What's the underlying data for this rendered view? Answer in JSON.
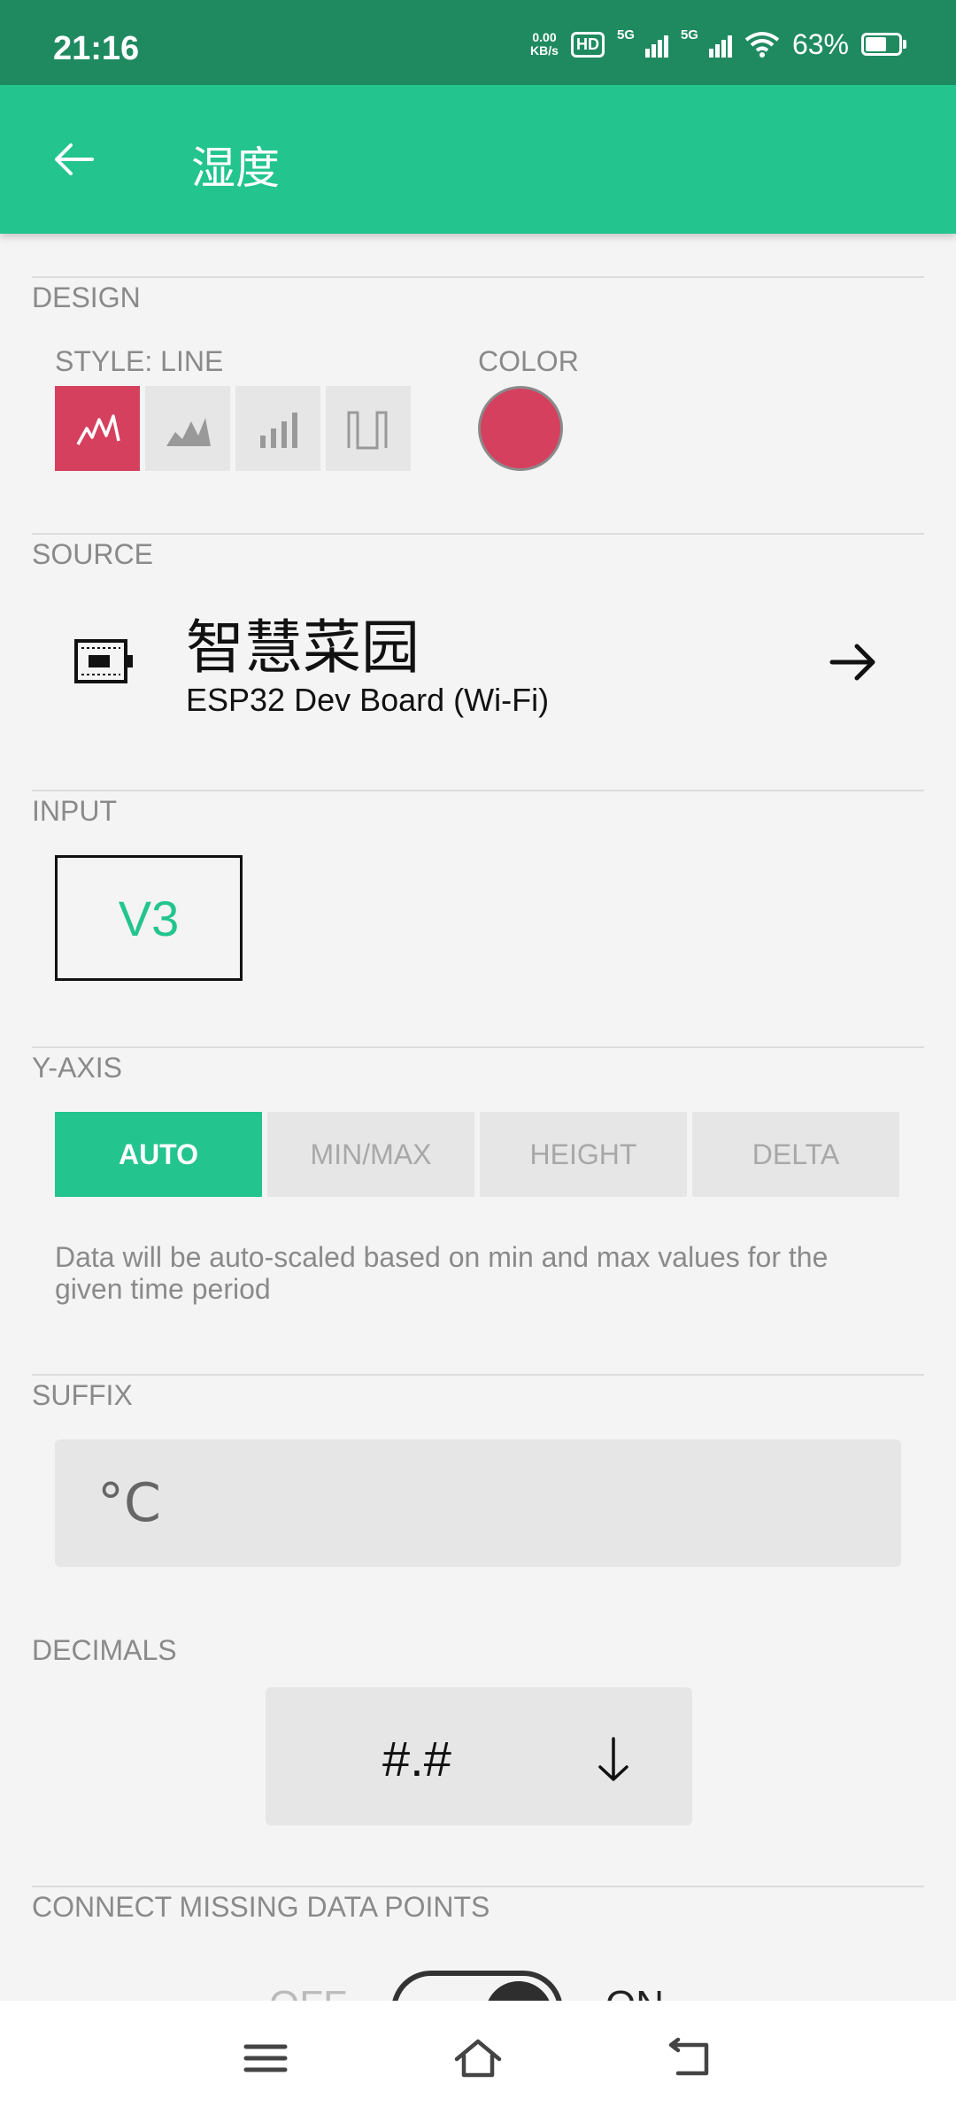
{
  "status_bar": {
    "time": "21:16",
    "net_speed": "0.00",
    "net_unit": "KB/s",
    "hd_label": "HD",
    "signal_1_label": "5G",
    "signal_2_label": "5G",
    "battery_percent": "63%",
    "battery_level": 0.63
  },
  "app_bar": {
    "title": "湿度",
    "back_icon": "arrow-left-icon"
  },
  "design": {
    "section_label": "DESIGN",
    "style_label": "STYLE: LINE",
    "styles": [
      "line",
      "area",
      "bar",
      "binary"
    ],
    "selected_style": "line",
    "color_label": "COLOR",
    "color": "#d6405f"
  },
  "source": {
    "section_label": "SOURCE",
    "device_name": "智慧菜园",
    "device_type": "ESP32 Dev Board (Wi-Fi)",
    "device_icon": "board-icon",
    "arrow_icon": "arrow-right-icon"
  },
  "input": {
    "section_label": "INPUT",
    "pin": "V3",
    "pin_color": "#23c48e"
  },
  "y_axis": {
    "section_label": "Y-AXIS",
    "options": [
      "AUTO",
      "MIN/MAX",
      "HEIGHT",
      "DELTA"
    ],
    "selected": "AUTO",
    "help_text": "Data will be auto-scaled based on min and max values for the given time period"
  },
  "suffix": {
    "section_label": "SUFFIX",
    "value": "°C"
  },
  "decimals": {
    "section_label": "DECIMALS",
    "value": "#.#",
    "dropdown_icon": "arrow-down-icon"
  },
  "connect_missing": {
    "section_label": "CONNECT MISSING DATA POINTS",
    "off_label": "OFF",
    "on_label": "ON",
    "enabled": true
  },
  "nav_bar": {
    "icons": [
      "menu-icon",
      "home-icon",
      "back-icon"
    ]
  },
  "colors": {
    "status_bar": "#1f8a60",
    "accent": "#23c48e",
    "background": "#f4f4f4"
  }
}
